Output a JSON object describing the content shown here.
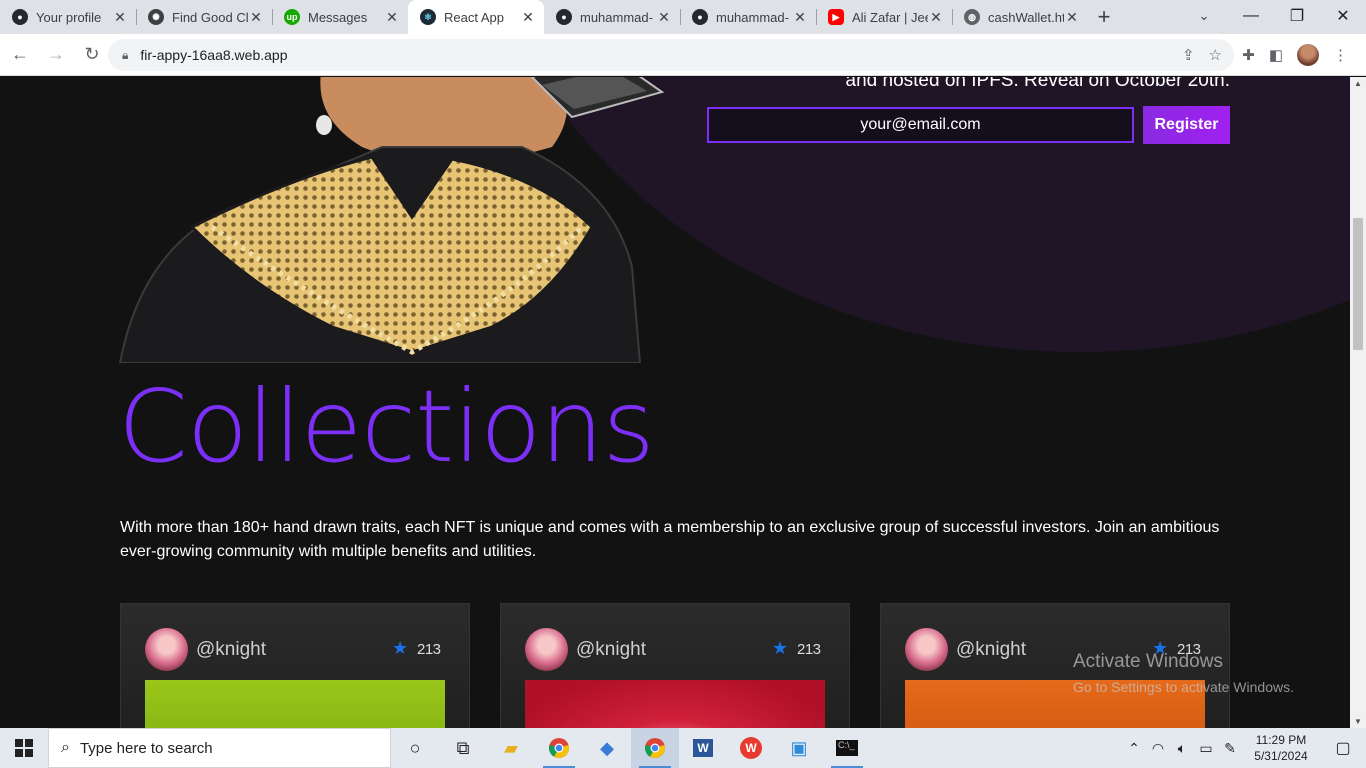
{
  "browser": {
    "tabs": [
      {
        "title": "Your profile",
        "icon": "github-icon",
        "color": "#24292f"
      },
      {
        "title": "Find Good Cli",
        "icon": "openai-icon",
        "color": "#3c4043"
      },
      {
        "title": "Messages",
        "icon": "upwork-icon",
        "color": "#14a800"
      },
      {
        "title": "React App",
        "icon": "react-icon",
        "color": "#1c2b36"
      },
      {
        "title": "muhammad-",
        "icon": "github-icon",
        "color": "#24292f"
      },
      {
        "title": "muhammad-",
        "icon": "github-icon",
        "color": "#24292f"
      },
      {
        "title": "Ali Zafar | Jee",
        "icon": "youtube-icon",
        "color": "#ff0000"
      },
      {
        "title": "cashWallet.htr",
        "icon": "globe-icon",
        "color": "#5f6368"
      }
    ],
    "active_tab": 3,
    "url": "fir-appy-16aa8.web.app"
  },
  "hero": {
    "hosted_text": "and hosted on IPFS. Reveal on October 20th.",
    "email_value": "your@email.com",
    "register_label": "Register"
  },
  "collections": {
    "title": "Collections",
    "description": "With more than 180+ hand drawn traits, each NFT is unique and comes with a membership to an exclusive group of successful investors. Join an ambitious ever-growing community with multiple benefits and utilities.",
    "cards": [
      {
        "handle": "@knight",
        "count": "213",
        "image_color": "green"
      },
      {
        "handle": "@knight",
        "count": "213",
        "image_color": "red"
      },
      {
        "handle": "@knight",
        "count": "213",
        "image_color": "orange"
      }
    ]
  },
  "watermark": {
    "line1": "Activate Windows",
    "line2": "Go to Settings to activate Windows."
  },
  "taskbar": {
    "search_placeholder": "Type here to search",
    "time": "11:29 PM",
    "date": "5/31/2024"
  }
}
